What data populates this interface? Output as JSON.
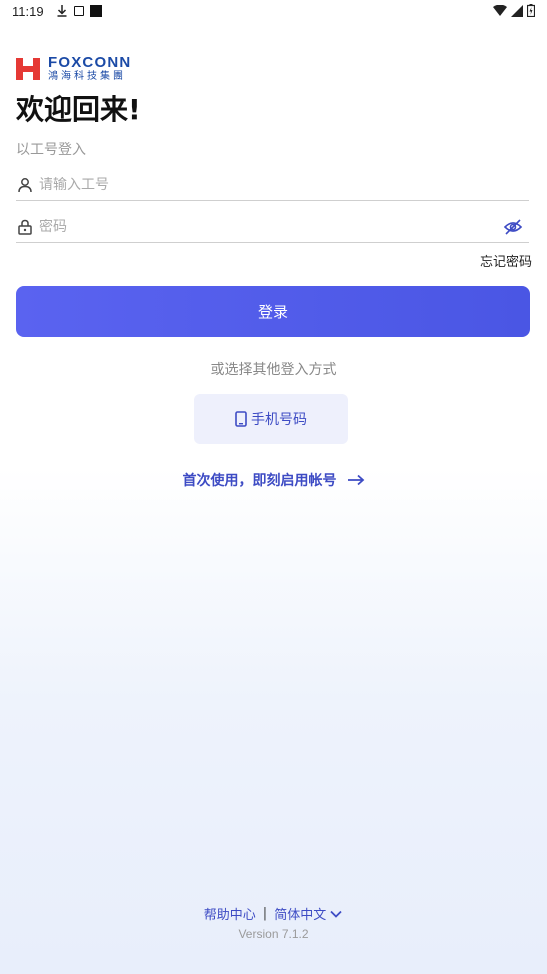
{
  "status_bar": {
    "time": "11:19"
  },
  "brand": {
    "name_en": "FOXCONN",
    "name_cn": "鴻海科技集團",
    "color": "#1b4aa6",
    "mark_color": "#e53935"
  },
  "header": {
    "title": "欢迎回来!",
    "subtitle": "以工号登入"
  },
  "form": {
    "username_placeholder": "请输入工号",
    "password_placeholder": "密码",
    "forgot_label": "忘记密码",
    "login_label": "登录"
  },
  "alternate": {
    "prompt": "或选择其他登入方式",
    "phone_label": "手机号码"
  },
  "activate": {
    "label": "首次使用，即刻启用帐号"
  },
  "footer": {
    "help_label": "帮助中心",
    "separator": "|",
    "language_label": "简体中文",
    "version": "Version 7.1.2"
  },
  "colors": {
    "accent": "#4a56e4",
    "link": "#3d4bc4"
  }
}
